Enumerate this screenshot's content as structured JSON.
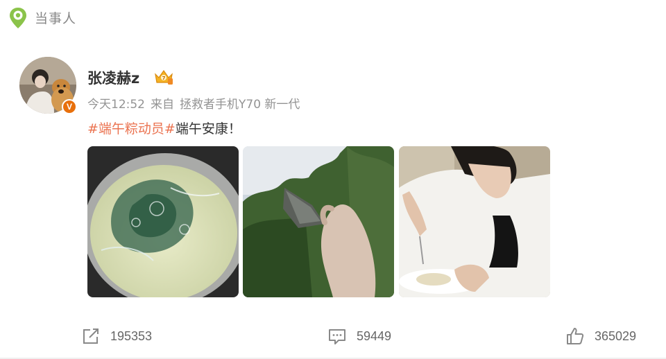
{
  "header": {
    "title": "当事人",
    "icon": "location-pin-icon"
  },
  "post": {
    "username": "张凌赫z",
    "verified_badge": "V",
    "time": "今天12:52",
    "source_prefix": "来自",
    "source_device": "拯救者手机Y70 新一代",
    "hashtag": "#端午粽动员#",
    "text": "端午安康！",
    "images": [
      "zongzi-boiling-pot-photo",
      "hand-holding-zongzi-trees-photo",
      "man-eating-photo"
    ]
  },
  "actions": {
    "repost_count": "195353",
    "comment_count": "59449",
    "like_count": "365029"
  },
  "colors": {
    "hashtag": "#eb7350",
    "meta": "#939393",
    "badge": "#e8700c",
    "header_icon": "#8bc34a"
  }
}
